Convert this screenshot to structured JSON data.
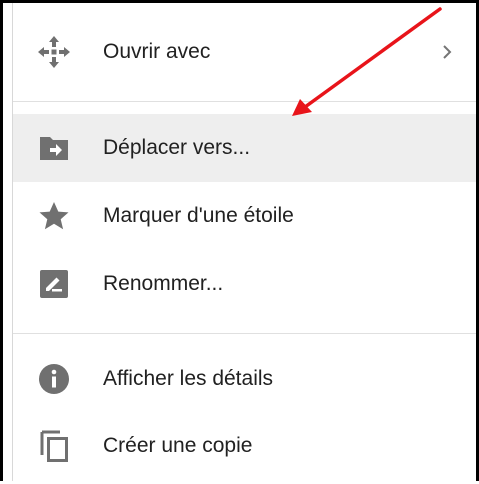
{
  "menu": {
    "items": [
      {
        "label": "Ouvrir avec",
        "icon": "move-arrows-icon",
        "has_submenu": true
      },
      {
        "label": "Déplacer vers...",
        "icon": "folder-move-icon",
        "highlighted": true
      },
      {
        "label": "Marquer d'une étoile",
        "icon": "star-icon"
      },
      {
        "label": "Renommer...",
        "icon": "rename-pencil-icon"
      },
      {
        "label": "Afficher les détails",
        "icon": "info-icon"
      },
      {
        "label": "Créer une copie",
        "icon": "copy-icon"
      }
    ]
  },
  "colors": {
    "icon": "#707070",
    "text": "#212121",
    "highlight_bg": "#eeeeee",
    "annotation_arrow": "#e8141a"
  }
}
